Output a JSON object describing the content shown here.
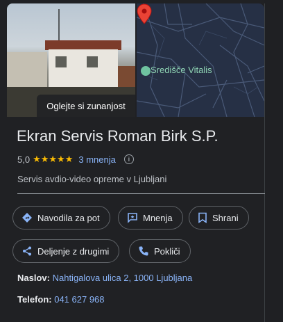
{
  "media": {
    "photo_button_label": "Oglejte si zunanjost",
    "map_place_label": "Središče Vitalis"
  },
  "business": {
    "name": "Ekran Servis Roman Birk S.P.",
    "rating": "5,0",
    "stars": "★★★★★",
    "reviews_label": "3 mnenja",
    "category": "Servis avdio-video opreme v Ljubljani"
  },
  "actions": {
    "directions": "Navodila za pot",
    "reviews": "Mnenja",
    "save": "Shrani",
    "share": "Deljenje z drugimi",
    "call": "Pokliči"
  },
  "details": {
    "address_label": "Naslov:",
    "address_value": "Nahtigalova ulica 2, 1000 Ljubljana",
    "phone_label": "Telefon:",
    "phone_value": "041 627 968"
  },
  "colors": {
    "background": "#202124",
    "link": "#8ab4f8",
    "star": "#fbbc04",
    "pin": "#ea4335"
  }
}
